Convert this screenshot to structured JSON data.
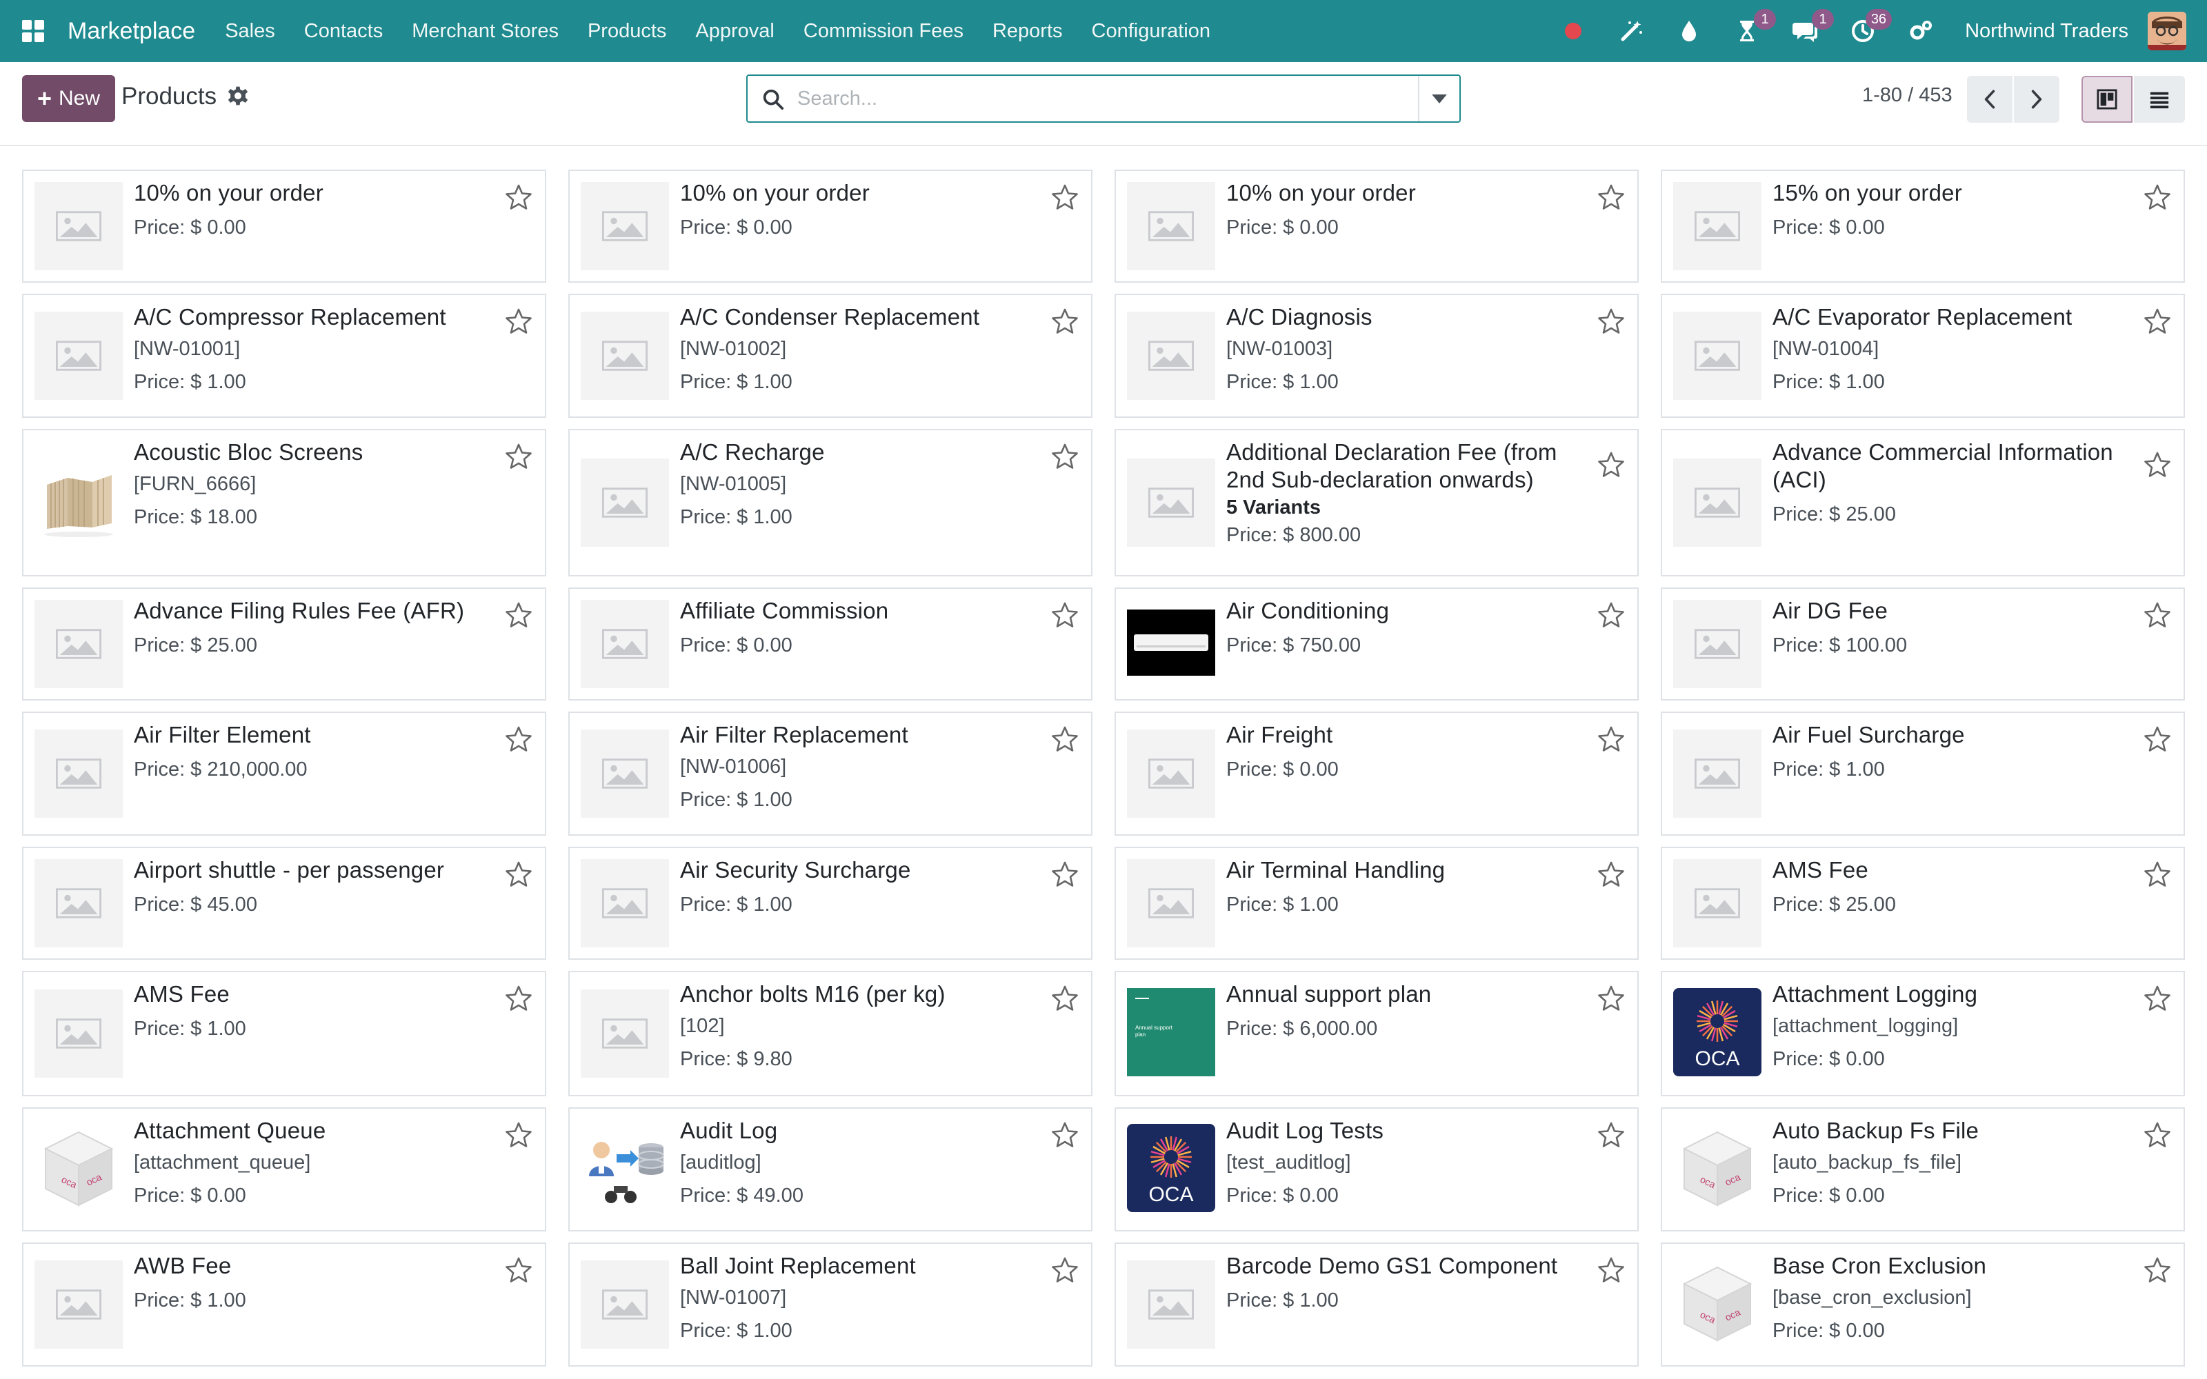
{
  "navbar": {
    "brand": "Marketplace",
    "menu": [
      "Sales",
      "Contacts",
      "Merchant Stores",
      "Products",
      "Approval",
      "Commission Fees",
      "Reports",
      "Configuration"
    ],
    "badges": {
      "activity_timer": "1",
      "messages": "1",
      "activities": "36"
    },
    "company": "Northwind Traders"
  },
  "control_panel": {
    "new_label": "New",
    "title": "Products",
    "search_placeholder": "Search...",
    "pager": "1-80 / 453"
  },
  "products": [
    {
      "name": "10% on your order",
      "ref": "",
      "variants": "",
      "price": "Price: $ 0.00",
      "image": "placeholder"
    },
    {
      "name": "10% on your order",
      "ref": "",
      "variants": "",
      "price": "Price: $ 0.00",
      "image": "placeholder"
    },
    {
      "name": "10% on your order",
      "ref": "",
      "variants": "",
      "price": "Price: $ 0.00",
      "image": "placeholder"
    },
    {
      "name": "15% on your order",
      "ref": "",
      "variants": "",
      "price": "Price: $ 0.00",
      "image": "placeholder"
    },
    {
      "name": "A/C Compressor Replacement",
      "ref": "[NW-01001]",
      "variants": "",
      "price": "Price: $ 1.00",
      "image": "placeholder"
    },
    {
      "name": "A/C Condenser Replacement",
      "ref": "[NW-01002]",
      "variants": "",
      "price": "Price: $ 1.00",
      "image": "placeholder"
    },
    {
      "name": "A/C Diagnosis",
      "ref": "[NW-01003]",
      "variants": "",
      "price": "Price: $ 1.00",
      "image": "placeholder"
    },
    {
      "name": "A/C Evaporator Replacement",
      "ref": "[NW-01004]",
      "variants": "",
      "price": "Price: $ 1.00",
      "image": "placeholder"
    },
    {
      "name": "Acoustic Bloc Screens",
      "ref": "[FURN_6666]",
      "variants": "",
      "price": "Price: $ 18.00",
      "image": "screens"
    },
    {
      "name": "A/C Recharge",
      "ref": "[NW-01005]",
      "variants": "",
      "price": "Price: $ 1.00",
      "image": "placeholder"
    },
    {
      "name": "Additional Declaration Fee (from 2nd Sub-declaration onwards)",
      "ref": "",
      "variants": "5 Variants",
      "price": "Price: $ 800.00",
      "image": "placeholder"
    },
    {
      "name": "Advance Commercial Information (ACI)",
      "ref": "",
      "variants": "",
      "price": "Price: $ 25.00",
      "image": "placeholder"
    },
    {
      "name": "Advance Filing Rules Fee (AFR)",
      "ref": "",
      "variants": "",
      "price": "Price: $ 25.00",
      "image": "placeholder"
    },
    {
      "name": "Affiliate Commission",
      "ref": "",
      "variants": "",
      "price": "Price: $ 0.00",
      "image": "placeholder"
    },
    {
      "name": "Air Conditioning",
      "ref": "",
      "variants": "",
      "price": "Price: $ 750.00",
      "image": "ac"
    },
    {
      "name": "Air DG Fee",
      "ref": "",
      "variants": "",
      "price": "Price: $ 100.00",
      "image": "placeholder"
    },
    {
      "name": "Air Filter Element",
      "ref": "",
      "variants": "",
      "price": "Price: $ 210,000.00",
      "image": "placeholder"
    },
    {
      "name": "Air Filter Replacement",
      "ref": "[NW-01006]",
      "variants": "",
      "price": "Price: $ 1.00",
      "image": "placeholder"
    },
    {
      "name": "Air Freight",
      "ref": "",
      "variants": "",
      "price": "Price: $ 0.00",
      "image": "placeholder"
    },
    {
      "name": "Air Fuel Surcharge",
      "ref": "",
      "variants": "",
      "price": "Price: $ 1.00",
      "image": "placeholder"
    },
    {
      "name": "Airport shuttle - per passenger",
      "ref": "",
      "variants": "",
      "price": "Price: $ 45.00",
      "image": "placeholder"
    },
    {
      "name": "Air Security Surcharge",
      "ref": "",
      "variants": "",
      "price": "Price: $ 1.00",
      "image": "placeholder"
    },
    {
      "name": "Air Terminal Handling",
      "ref": "",
      "variants": "",
      "price": "Price: $ 1.00",
      "image": "placeholder"
    },
    {
      "name": "AMS Fee",
      "ref": "",
      "variants": "",
      "price": "Price: $ 25.00",
      "image": "placeholder"
    },
    {
      "name": "AMS Fee",
      "ref": "",
      "variants": "",
      "price": "Price: $ 1.00",
      "image": "placeholder"
    },
    {
      "name": "Anchor bolts M16 (per kg)",
      "ref": "[102]",
      "variants": "",
      "price": "Price: $ 9.80",
      "image": "placeholder"
    },
    {
      "name": "Annual support plan",
      "ref": "",
      "variants": "",
      "price": "Price: $ 6,000.00",
      "image": "support"
    },
    {
      "name": "Attachment Logging",
      "ref": "[attachment_logging]",
      "variants": "",
      "price": "Price: $ 0.00",
      "image": "oca"
    },
    {
      "name": "Attachment Queue",
      "ref": "[attachment_queue]",
      "variants": "",
      "price": "Price: $ 0.00",
      "image": "cube"
    },
    {
      "name": "Audit Log",
      "ref": "[auditlog]",
      "variants": "",
      "price": "Price: $ 49.00",
      "image": "auditlog"
    },
    {
      "name": "Audit Log Tests",
      "ref": "[test_auditlog]",
      "variants": "",
      "price": "Price: $ 0.00",
      "image": "oca"
    },
    {
      "name": "Auto Backup Fs File",
      "ref": "[auto_backup_fs_file]",
      "variants": "",
      "price": "Price: $ 0.00",
      "image": "cube"
    },
    {
      "name": "AWB Fee",
      "ref": "",
      "variants": "",
      "price": "Price: $ 1.00",
      "image": "placeholder"
    },
    {
      "name": "Ball Joint Replacement",
      "ref": "[NW-01007]",
      "variants": "",
      "price": "Price: $ 1.00",
      "image": "placeholder"
    },
    {
      "name": "Barcode Demo GS1 Component",
      "ref": "",
      "variants": "",
      "price": "Price: $ 1.00",
      "image": "placeholder"
    },
    {
      "name": "Base Cron Exclusion",
      "ref": "[base_cron_exclusion]",
      "variants": "",
      "price": "Price: $ 0.00",
      "image": "cube"
    }
  ],
  "image_texts": {
    "oca": "OCA",
    "oca_small": "oca",
    "support_line1": "Annual support",
    "support_line2": "plan"
  }
}
